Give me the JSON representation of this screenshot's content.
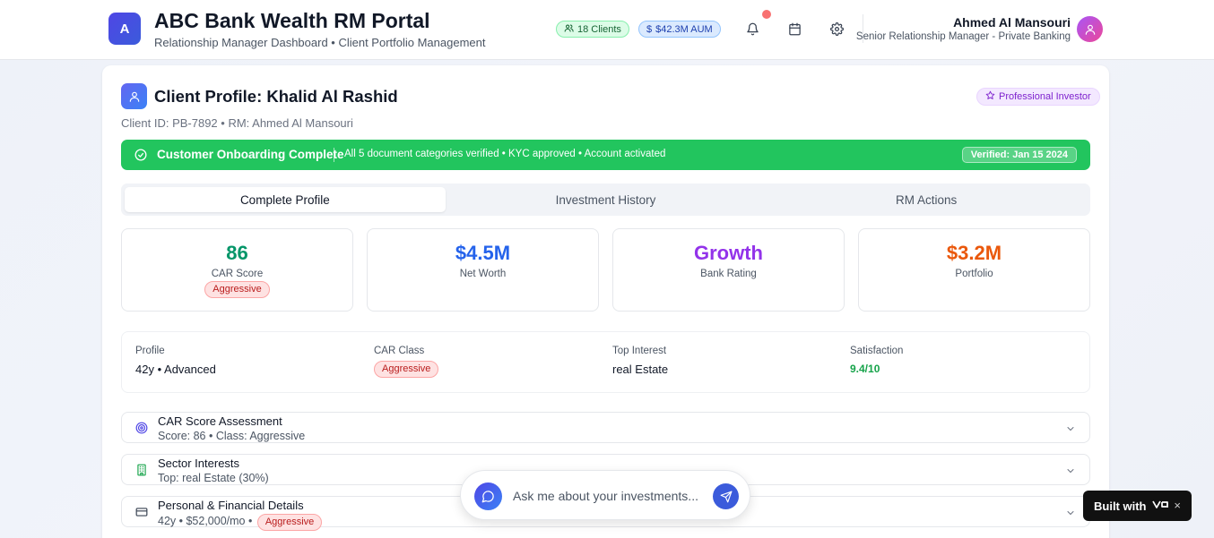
{
  "header": {
    "logo_letter": "A",
    "title": "ABC Bank Wealth RM Portal",
    "subtitle": "Relationship Manager Dashboard • Client Portfolio Management",
    "clients_pill": "18 Clients",
    "aum_pill": "$42.3M AUM",
    "user_name": "Ahmed Al Mansouri",
    "user_role": "Senior Relationship Manager - Private Banking",
    "icons": [
      "bell-icon",
      "calendar-icon",
      "gear-icon"
    ]
  },
  "profile": {
    "title": "Client Profile: Khalid Al Rashid",
    "meta": "Client ID: PB-7892 • RM: Ahmed Al Mansouri",
    "investor_badge": "Professional Investor"
  },
  "onboarding": {
    "title": "Customer Onboarding Complete",
    "description": "All 5 document categories verified • KYC approved • Account activated",
    "verified": "Verified: Jan 15 2024"
  },
  "tabs": [
    {
      "label": "Complete Profile",
      "active": true
    },
    {
      "label": "Investment History",
      "active": false
    },
    {
      "label": "RM Actions",
      "active": false
    }
  ],
  "stats": [
    {
      "value": "86",
      "label": "CAR Score",
      "tag": "Aggressive",
      "color": "#059669"
    },
    {
      "value": "$4.5M",
      "label": "Net Worth",
      "color": "#2563eb"
    },
    {
      "value": "Growth",
      "label": "Bank Rating",
      "color": "#9333ea"
    },
    {
      "value": "$3.2M",
      "label": "Portfolio",
      "color": "#ea580c"
    }
  ],
  "summary": {
    "profile_label": "Profile",
    "profile_value": "42y • Advanced",
    "car_class_label": "CAR Class",
    "car_class_value": "Aggressive",
    "top_interest_label": "Top Interest",
    "top_interest_value": "real Estate",
    "satisfaction_label": "Satisfaction",
    "satisfaction_value": "9.4/10"
  },
  "accordions": [
    {
      "title": "CAR Score Assessment",
      "subtitle": "Score: 86 • Class: Aggressive",
      "icon": "target-icon"
    },
    {
      "title": "Sector Interests",
      "subtitle": "Top: real Estate (30%)",
      "icon": "building-icon"
    },
    {
      "title": "Personal & Financial Details",
      "subtitle": "42y • $52,000/mo •",
      "tag": "Aggressive",
      "icon": "credit-card-icon"
    }
  ],
  "chat": {
    "placeholder": "Ask me about your investments..."
  },
  "built_with": {
    "label": "Built with",
    "close": "×"
  },
  "colors": {
    "accent": "#3b5bdb",
    "success": "#22c55e",
    "satisfaction": "#16a34a"
  }
}
